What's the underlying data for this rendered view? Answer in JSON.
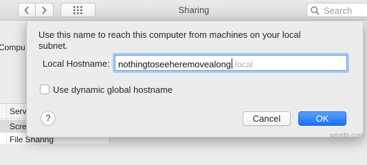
{
  "window": {
    "title": "Sharing",
    "search_placeholder": "Search"
  },
  "background": {
    "computer_name_label_fragment": "Compu",
    "list_header_fragment": "Serv",
    "list_items": [
      "Scre",
      "File Sharing"
    ]
  },
  "dialog": {
    "instruction": "Use this name to reach this computer from machines on your local subnet.",
    "hostname_label": "Local Hostname:",
    "hostname_value": "nothingtoseeheremovealong",
    "hostname_suffix": ".local",
    "dynamic_hostname_label": "Use dynamic global hostname",
    "dynamic_hostname_checked": false,
    "help_label": "?",
    "cancel_label": "Cancel",
    "ok_label": "OK"
  },
  "watermark": "wsxdn.com",
  "colors": {
    "accent": "#1a6ff4",
    "focus_ring": "#a5c8f5",
    "window_bg": "#ececec"
  }
}
